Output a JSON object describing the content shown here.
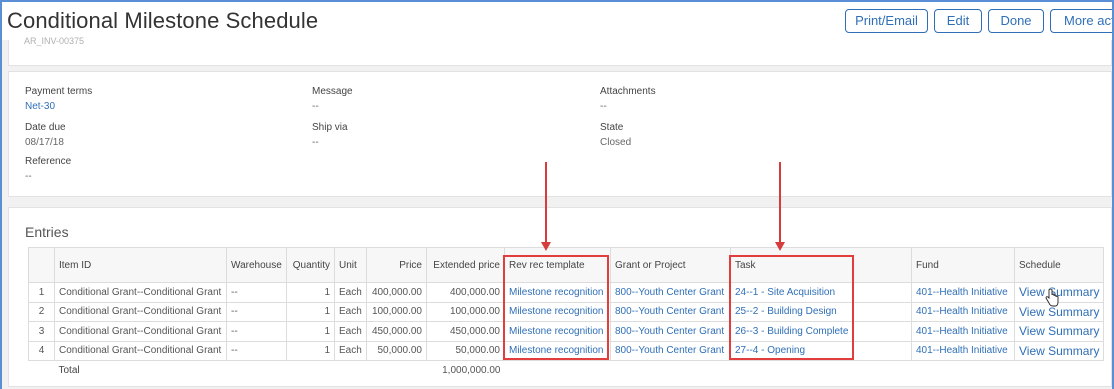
{
  "header": {
    "title": "Conditional Milestone Schedule",
    "subline": "AR_INV-00375",
    "buttons": {
      "print_email": "Print/Email",
      "edit": "Edit",
      "done": "Done",
      "more_actions": "More actions"
    }
  },
  "details": {
    "payment_terms": {
      "label": "Payment terms",
      "value": "Net-30"
    },
    "message": {
      "label": "Message",
      "value": "--"
    },
    "attachments": {
      "label": "Attachments",
      "value": "--"
    },
    "date_due": {
      "label": "Date due",
      "value": "08/17/18"
    },
    "ship_via": {
      "label": "Ship via",
      "value": "--"
    },
    "state": {
      "label": "State",
      "value": "Closed"
    },
    "reference": {
      "label": "Reference",
      "value": "--"
    }
  },
  "entries": {
    "title": "Entries",
    "columns": {
      "num": "",
      "item_id": "Item ID",
      "warehouse": "Warehouse",
      "quantity": "Quantity",
      "unit": "Unit",
      "price": "Price",
      "extended_price": "Extended price",
      "rev_rec_template": "Rev rec template",
      "grant_or_project": "Grant or Project",
      "task": "Task",
      "fund": "Fund",
      "schedule": "Schedule"
    },
    "rows": [
      {
        "num": "1",
        "item_id": "Conditional Grant--Conditional Grant",
        "warehouse": "--",
        "quantity": "1",
        "unit": "Each",
        "price": "400,000.00",
        "extended_price": "400,000.00",
        "rev_rec_template": "Milestone recognition",
        "grant_or_project": "800--Youth Center Grant",
        "task": "24--1 - Site Acquisition",
        "fund": "401--Health Initiative",
        "schedule": "View Summary"
      },
      {
        "num": "2",
        "item_id": "Conditional Grant--Conditional Grant",
        "warehouse": "--",
        "quantity": "1",
        "unit": "Each",
        "price": "100,000.00",
        "extended_price": "100,000.00",
        "rev_rec_template": "Milestone recognition",
        "grant_or_project": "800--Youth Center Grant",
        "task": "25--2 - Building Design",
        "fund": "401--Health Initiative",
        "schedule": "View Summary"
      },
      {
        "num": "3",
        "item_id": "Conditional Grant--Conditional Grant",
        "warehouse": "--",
        "quantity": "1",
        "unit": "Each",
        "price": "450,000.00",
        "extended_price": "450,000.00",
        "rev_rec_template": "Milestone recognition",
        "grant_or_project": "800--Youth Center Grant",
        "task": "26--3 - Building Complete",
        "fund": "401--Health Initiative",
        "schedule": "View Summary"
      },
      {
        "num": "4",
        "item_id": "Conditional Grant--Conditional Grant",
        "warehouse": "--",
        "quantity": "1",
        "unit": "Each",
        "price": "50,000.00",
        "extended_price": "50,000.00",
        "rev_rec_template": "Milestone recognition",
        "grant_or_project": "800--Youth Center Grant",
        "task": "27--4 - Opening",
        "fund": "401--Health Initiative",
        "schedule": "View Summary"
      }
    ],
    "total_label": "Total",
    "total_value": "1,000,000.00"
  },
  "colors": {
    "link": "#2f6fb7",
    "annotation_red": "#e23d3d",
    "frame_blue": "#5a8fd6"
  }
}
